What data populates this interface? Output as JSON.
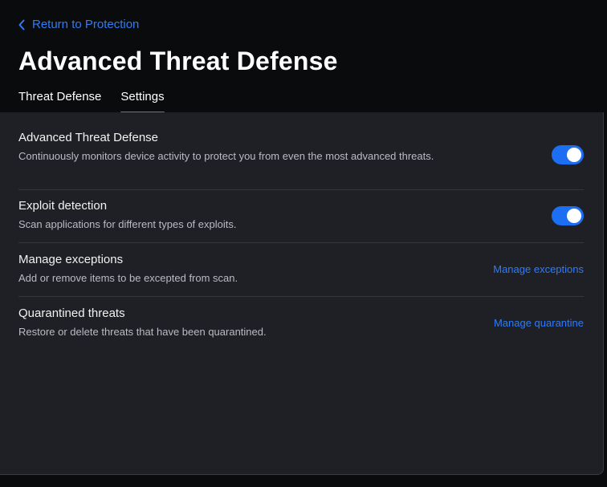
{
  "header": {
    "back_label": "Return to Protection",
    "title": "Advanced Threat Defense",
    "tabs": [
      {
        "label": "Threat Defense",
        "active": false
      },
      {
        "label": "Settings",
        "active": true
      }
    ]
  },
  "settings": [
    {
      "title": "Advanced Threat Defense",
      "description": "Continuously monitors device activity to protect you from even the most advanced threats.",
      "control": "toggle",
      "enabled": true
    },
    {
      "title": "Exploit detection",
      "description": "Scan applications for different types of exploits.",
      "control": "toggle",
      "enabled": true
    },
    {
      "title": "Manage exceptions",
      "description": "Add or remove items to be excepted from scan.",
      "control": "link",
      "link_label": "Manage exceptions"
    },
    {
      "title": "Quarantined threats",
      "description": "Restore or delete threats that have been quarantined.",
      "control": "link",
      "link_label": "Manage quarantine"
    }
  ],
  "colors": {
    "accent": "#2f7cf6",
    "toggle_on": "#1c6ef2",
    "panel_bg": "#1f2025",
    "header_bg": "#0a0b0d"
  },
  "icons": {
    "back": "chevron-left-icon"
  }
}
